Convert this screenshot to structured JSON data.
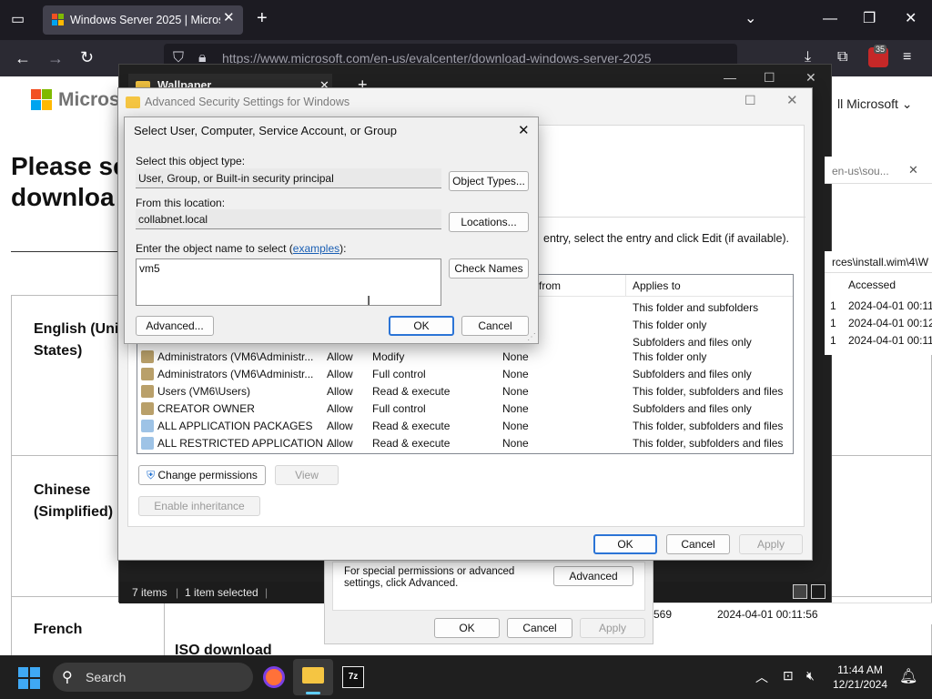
{
  "browser": {
    "tab_title": "Windows Server 2025 | Microso",
    "url": "https://www.microsoft.com/en-us/evalcenter/download-windows-server-2025",
    "extension_badge": "35"
  },
  "page": {
    "brand": "Microso",
    "all_microsoft": "ll Microsoft",
    "heading_line1": "Please se",
    "heading_line2": "downloa",
    "languages": [
      "English (Unit",
      "States)",
      "Chinese",
      "(Simplified)",
      "French"
    ],
    "iso_download": "ISO download"
  },
  "explorer": {
    "tab_title": "Wallpaper",
    "address_fragment": "en-us\\sou...",
    "path_fragment": "rces\\install.wim\\4\\W",
    "col_accessed": "Accessed",
    "accessed_values": [
      "2024-04-01 00:11",
      "2024-04-01 00:12",
      "2024-04-01 00:11"
    ],
    "row_bottom_num": "569",
    "row_bottom_date": "2024-04-01 00:11:56",
    "status_items": "7 items",
    "status_selected": "1 item selected"
  },
  "properties": {
    "note": "For special permissions or advanced settings, click Advanced.",
    "advanced_btn": "Advanced",
    "ok": "OK",
    "cancel": "Cancel",
    "apply": "Apply"
  },
  "advanced_security": {
    "title": "Advanced Security Settings for Windows",
    "instruction_fragment": "entry, select the entry and click Edit (if available).",
    "col_inherited": "d from",
    "col_applies": "Applies to",
    "top_applies": [
      "This folder and subfolders",
      "This folder only",
      "Subfolders and files only"
    ],
    "rows": [
      {
        "principal": "Administrators (VM6\\Administr...",
        "type": "Allow",
        "access": "Modify",
        "inherited": "None",
        "applies": "This folder only",
        "icon": "group-icon"
      },
      {
        "principal": "Administrators (VM6\\Administr...",
        "type": "Allow",
        "access": "Full control",
        "inherited": "None",
        "applies": "Subfolders and files only",
        "icon": "group-icon"
      },
      {
        "principal": "Users (VM6\\Users)",
        "type": "Allow",
        "access": "Read & execute",
        "inherited": "None",
        "applies": "This folder, subfolders and files",
        "icon": "group-icon"
      },
      {
        "principal": "CREATOR OWNER",
        "type": "Allow",
        "access": "Full control",
        "inherited": "None",
        "applies": "Subfolders and files only",
        "icon": "group-icon"
      },
      {
        "principal": "ALL APPLICATION PACKAGES",
        "type": "Allow",
        "access": "Read & execute",
        "inherited": "None",
        "applies": "This folder, subfolders and files",
        "icon": "package-icon"
      },
      {
        "principal": "ALL RESTRICTED APPLICATION ...",
        "type": "Allow",
        "access": "Read & execute",
        "inherited": "None",
        "applies": "This folder, subfolders and files",
        "icon": "package-icon"
      }
    ],
    "change_permissions": "Change permissions",
    "view": "View",
    "enable_inheritance": "Enable inheritance",
    "ok": "OK",
    "cancel": "Cancel",
    "apply": "Apply"
  },
  "select_user": {
    "title": "Select User, Computer, Service Account, or Group",
    "object_type_label": "Select this object type:",
    "object_type_value": "User, Group, or Built-in security principal",
    "object_types_btn": "Object Types...",
    "location_label": "From this location:",
    "location_value": "collabnet.local",
    "locations_btn": "Locations...",
    "name_label": "Enter the object name to select (",
    "name_label_link": "examples",
    "name_label_end": "):",
    "name_value": "vm5",
    "check_names_btn": "Check Names",
    "advanced_btn": "Advanced...",
    "ok": "OK",
    "cancel": "Cancel"
  },
  "taskbar": {
    "search": "Search",
    "time": "11:44 AM",
    "date": "12/21/2024"
  }
}
